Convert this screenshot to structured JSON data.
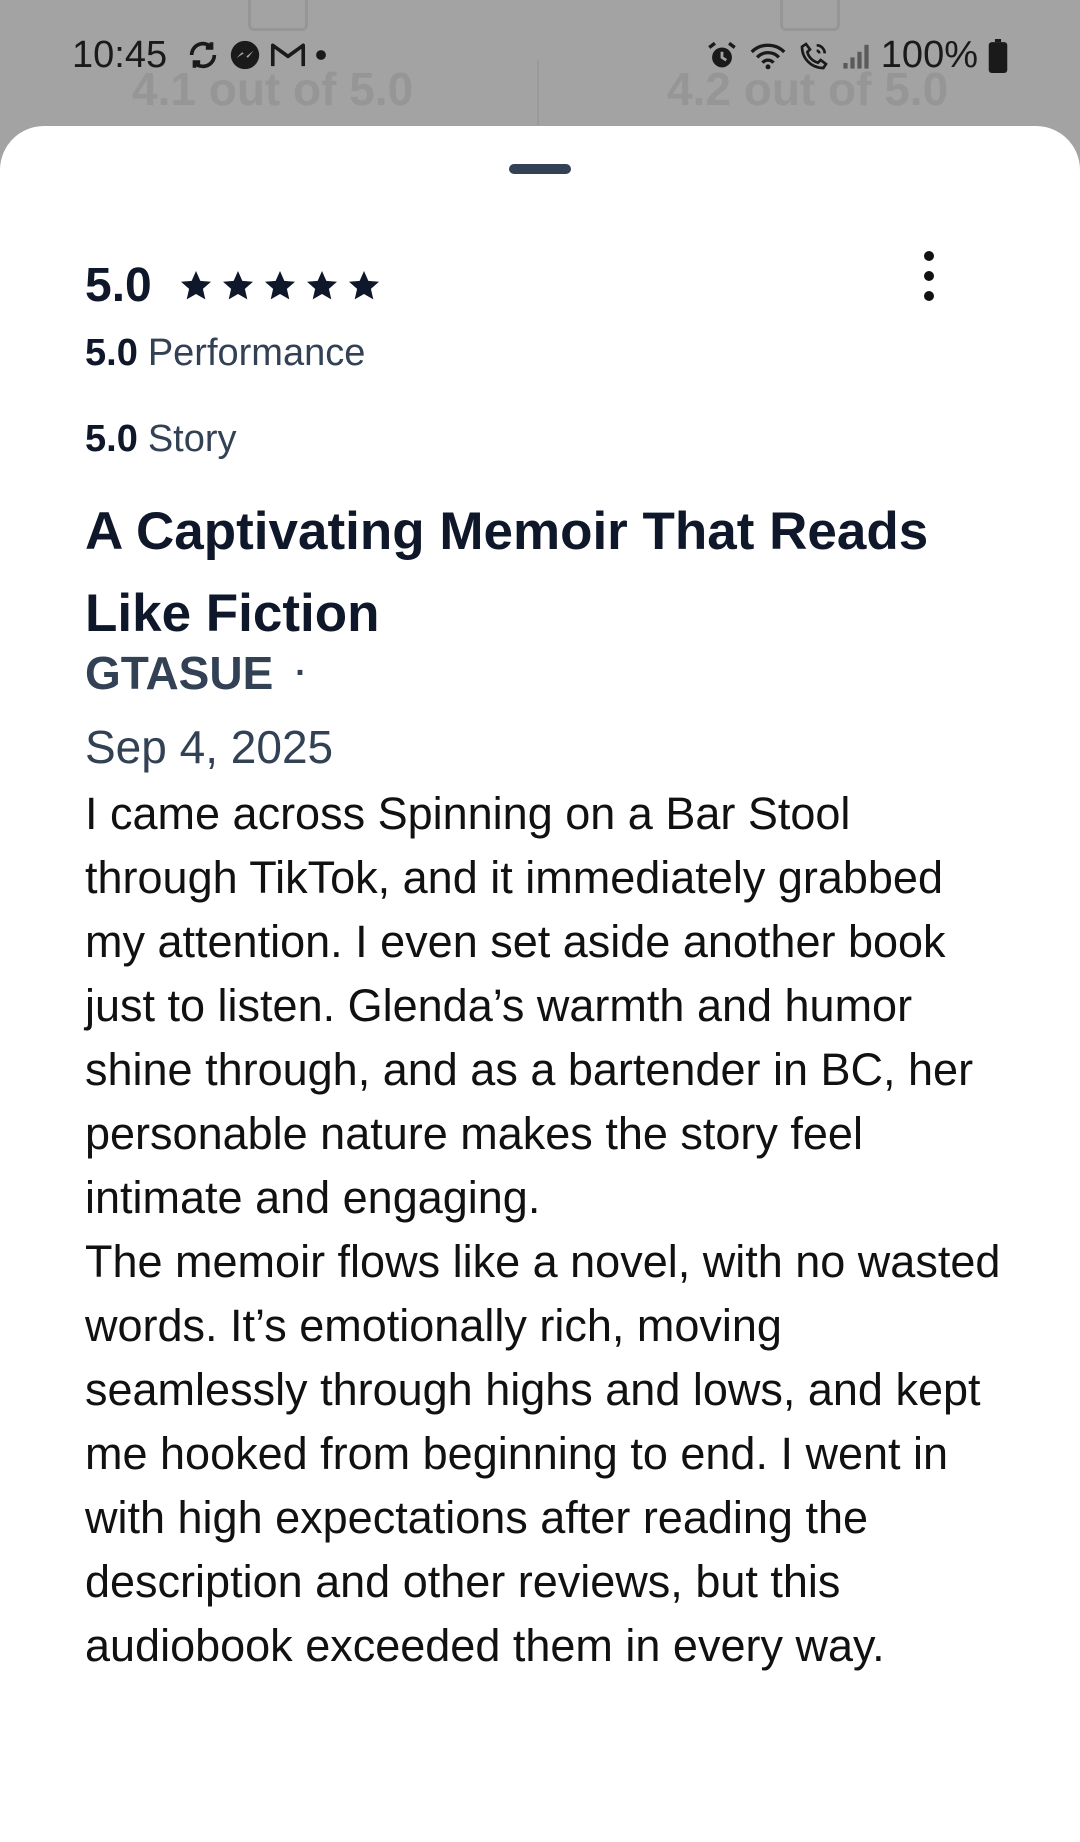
{
  "status_bar": {
    "time": "10:45",
    "left_icons": [
      "sync-icon",
      "messenger-icon",
      "gmail-icon",
      "dot-icon"
    ],
    "right_icons": [
      "alarm-icon",
      "wifi-icon",
      "wifi-calling-icon",
      "signal-icon",
      "battery-icon"
    ],
    "battery": "100%"
  },
  "background": {
    "left_rating": "4.1 out of 5.0",
    "right_rating": "4.2 out of 5.0"
  },
  "review": {
    "overall_score": "5.0",
    "stars": 5,
    "performance": {
      "score": "5.0",
      "label": "Performance"
    },
    "story": {
      "score": "5.0",
      "label": "Story"
    },
    "title": "A Captivating Memoir That Reads Like Fiction",
    "author": "GTASUE",
    "separator": "·",
    "date": "Sep 4, 2025",
    "body": [
      "I came across Spinning on a Bar Stool through TikTok, and it immediately grabbed my attention. I even set aside another book just to listen. Glenda’s warmth and humor shine through, and as a bartender in BC, her personable nature makes the story feel intimate and engaging.",
      "The memoir flows like a novel, with no wasted words. It’s emotionally rich, moving seamlessly through highs and lows, and kept me hooked from beginning to end. I went in with high expectations after reading the description and other reviews, but this audiobook exceeded them in every way."
    ]
  },
  "colors": {
    "sheet_background": "#ffffff",
    "dim_background": "#a3a3a3",
    "heading_text": "#0f172a",
    "secondary_text": "#334155",
    "body_text": "#111111"
  }
}
